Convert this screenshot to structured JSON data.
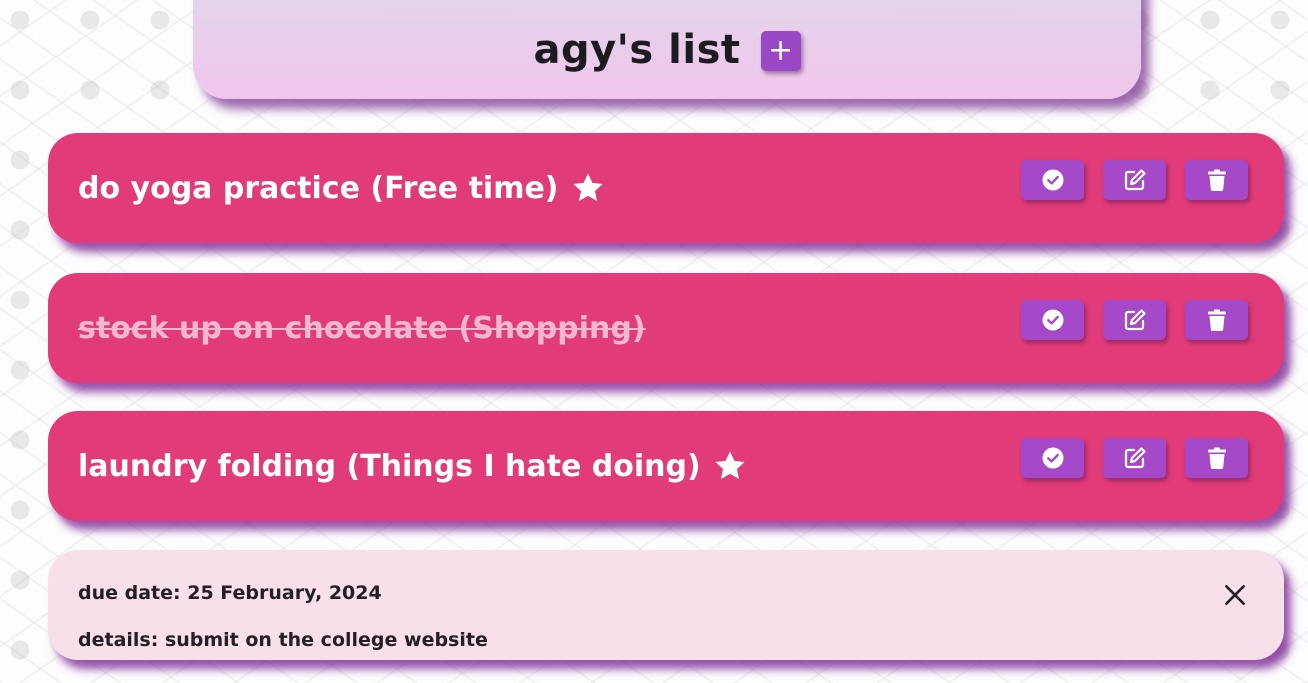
{
  "header": {
    "title": "agy's list",
    "add_label": "+"
  },
  "tasks": [
    {
      "text": "do yoga practice (Free time)",
      "starred": true,
      "completed": false
    },
    {
      "text": "stock up on chocolate (Shopping)",
      "starred": false,
      "completed": true
    },
    {
      "text": "laundry folding (Things I hate doing)",
      "starred": true,
      "completed": false
    }
  ],
  "details": {
    "due": "due date: 25 February, 2024",
    "info": "details: submit on the college website"
  },
  "icons": {
    "add": "plus-icon",
    "complete": "check-circle-icon",
    "edit": "edit-icon",
    "delete": "trash-icon",
    "star": "star-icon",
    "close": "close-icon"
  },
  "colors": {
    "task_bg": "#e23b79",
    "button_bg": "#a649c8",
    "header_bg": "#f0c6ec",
    "details_bg": "#f7e0ea"
  }
}
